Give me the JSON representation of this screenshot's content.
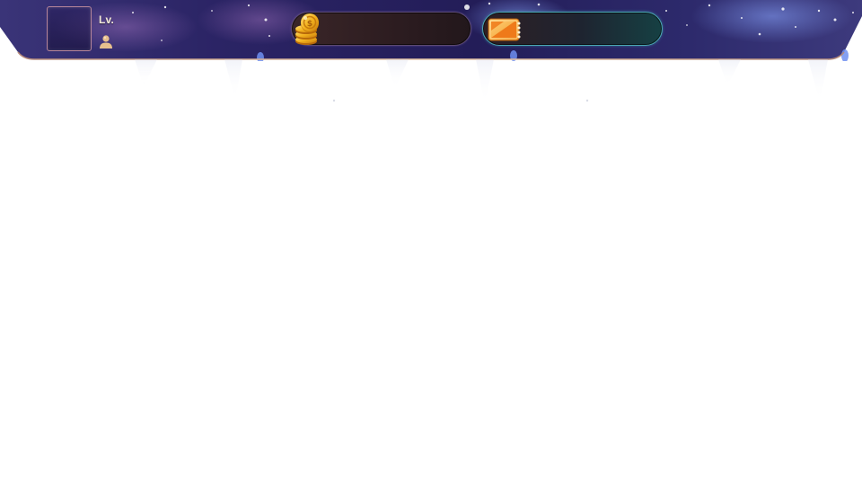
{
  "player": {
    "level_label": "Lv.",
    "level_value": "",
    "avatar_icon": "avatar-placeholder",
    "profile_icon": "user-icon"
  },
  "currencies": [
    {
      "name": "coins",
      "icon": "coin-stack-icon",
      "value": ""
    },
    {
      "name": "tickets",
      "icon": "ticket-icon",
      "value": ""
    }
  ],
  "colors": {
    "header_bg": "#2a2260",
    "coin_border": "#5c4a72",
    "ticket_border": "#4aa6b2",
    "gold": "#f3b21e",
    "ticket_orange": "#ef7a1a"
  }
}
